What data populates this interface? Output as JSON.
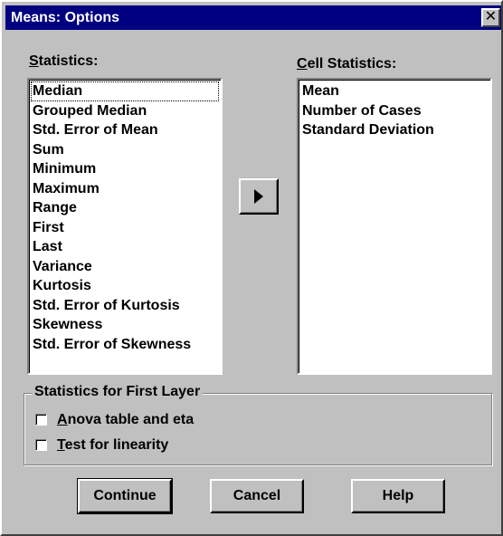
{
  "window": {
    "title": "Means: Options",
    "close_label": "✕"
  },
  "statistics": {
    "label_ul": "S",
    "label_rest": "tatistics:",
    "items": [
      "Median",
      "Grouped Median",
      "Std. Error of Mean",
      "Sum",
      "Minimum",
      "Maximum",
      "Range",
      "First",
      "Last",
      "Variance",
      "Kurtosis",
      "Std. Error of Kurtosis",
      "Skewness",
      "Std. Error of Skewness"
    ]
  },
  "cell_statistics": {
    "label_ul": "C",
    "label_rest": "ell Statistics:",
    "items": [
      "Mean",
      "Number of Cases",
      "Standard Deviation"
    ]
  },
  "move_button": {
    "icon": "right-arrow-icon"
  },
  "first_layer": {
    "legend": "Statistics for First Layer",
    "anova": {
      "ul": "A",
      "rest": "nova table and eta",
      "checked": false
    },
    "linearity": {
      "ul": "T",
      "rest": "est for linearity",
      "checked": false
    }
  },
  "buttons": {
    "continue": "Continue",
    "cancel": "Cancel",
    "help": "Help"
  }
}
